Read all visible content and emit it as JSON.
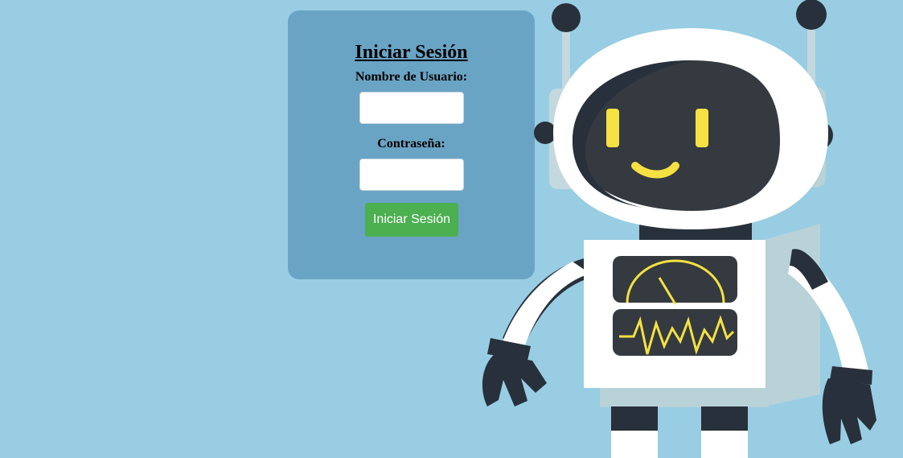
{
  "login": {
    "title": "Iniciar Sesión",
    "username_label": "Nombre de Usuario:",
    "username_value": "",
    "password_label": "Contraseña:",
    "password_value": "",
    "submit_label": "Iniciar Sesión"
  },
  "colors": {
    "background": "#98cde3",
    "card": "#6aa4c4",
    "button": "#4caf50",
    "robot_accent": "#f5e142",
    "robot_dark": "#343a40"
  },
  "illustration": {
    "subject": "robot-mascot-icon"
  }
}
